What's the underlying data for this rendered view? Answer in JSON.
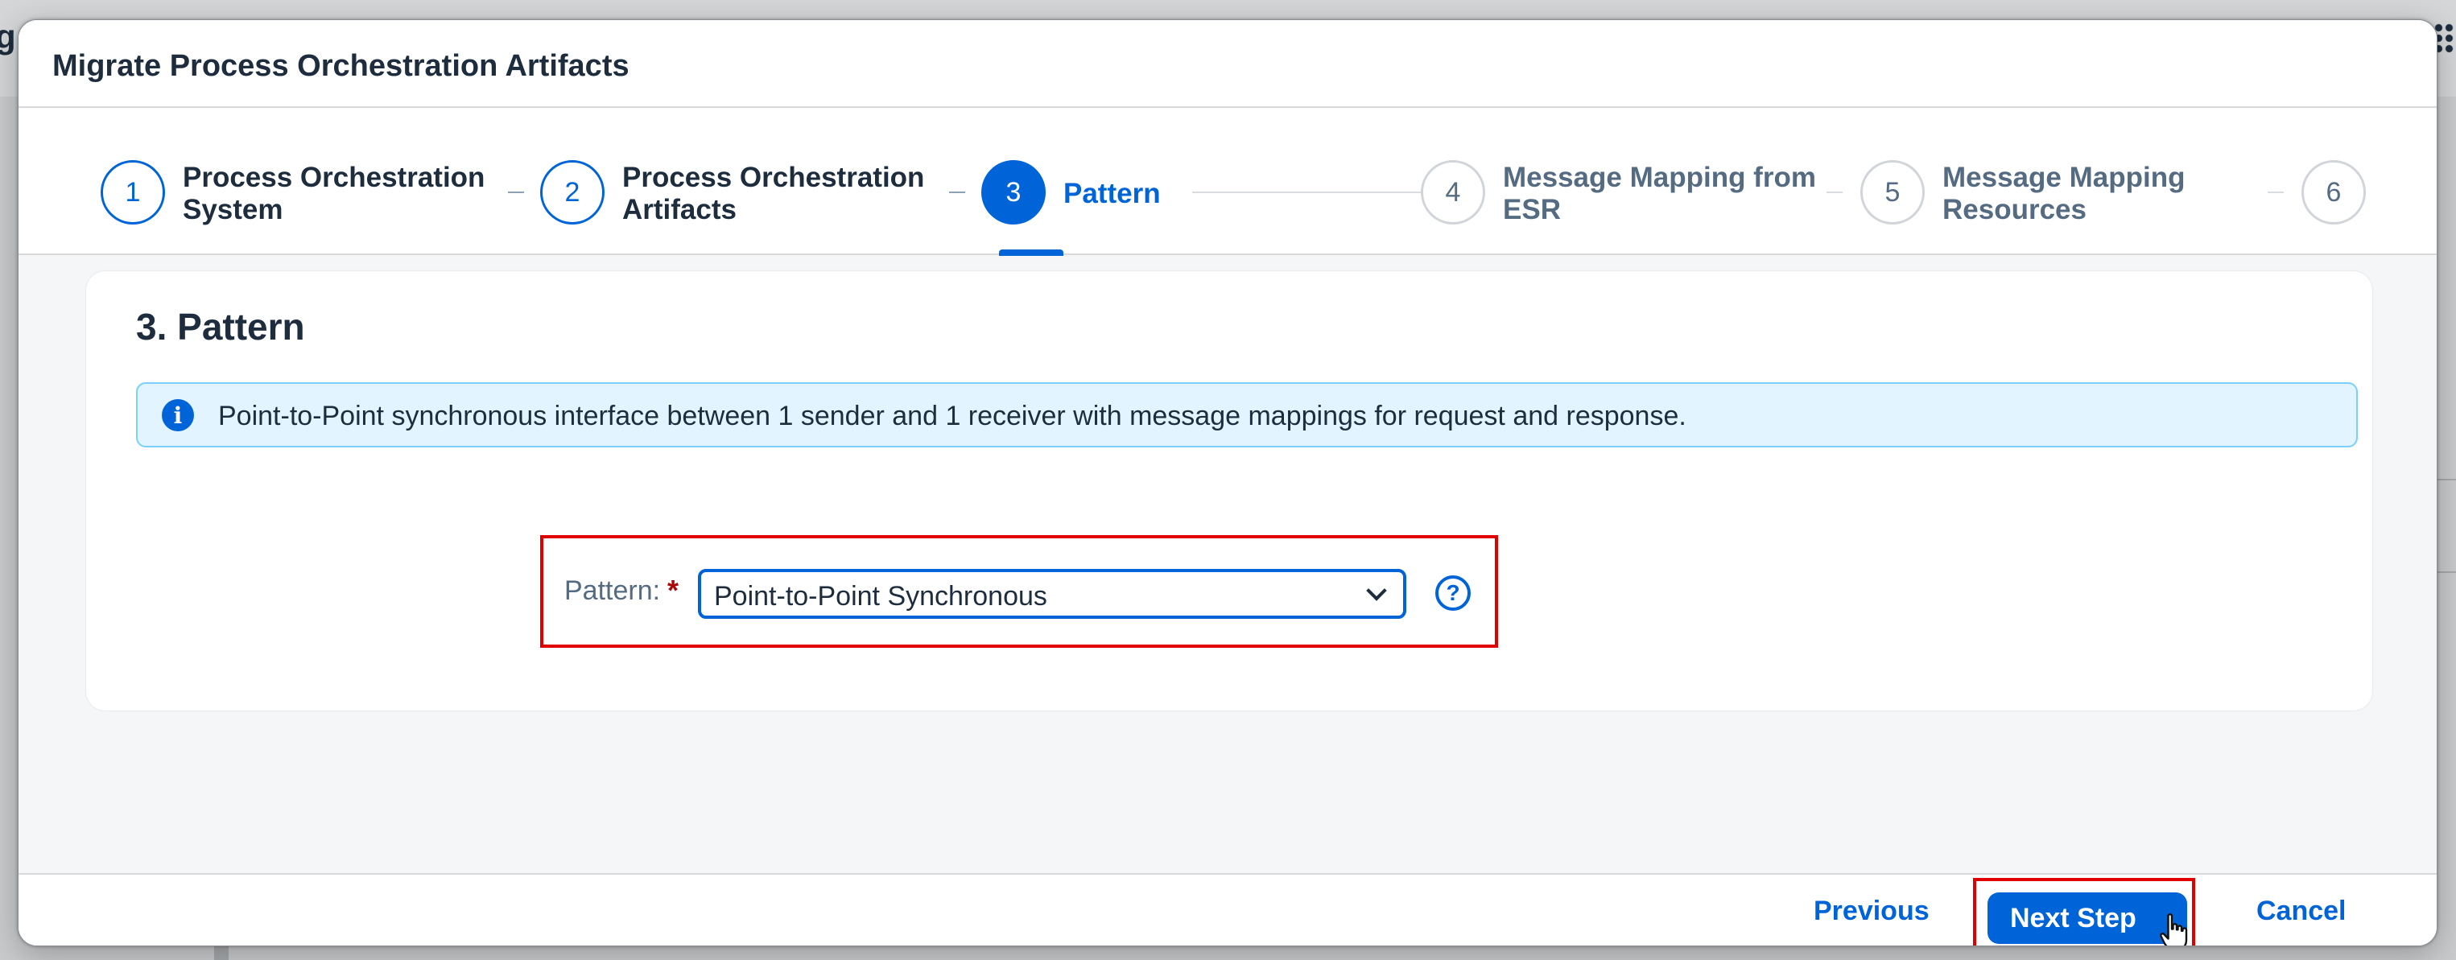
{
  "background": {
    "partial_letter": "g"
  },
  "dialog": {
    "title": "Migrate Process Orchestration Artifacts"
  },
  "wizard": {
    "steps": [
      {
        "number": "1",
        "label_line1": "Process Orchestration",
        "label_line2": "System",
        "state": "completed"
      },
      {
        "number": "2",
        "label_line1": "Process Orchestration",
        "label_line2": "Artifacts",
        "state": "completed"
      },
      {
        "number": "3",
        "label_line1": "Pattern",
        "label_line2": "",
        "state": "active"
      },
      {
        "number": "4",
        "label_line1": "Message Mapping from",
        "label_line2": "ESR",
        "state": "future"
      },
      {
        "number": "5",
        "label_line1": "Message Mapping",
        "label_line2": "Resources",
        "state": "future"
      },
      {
        "number": "6",
        "label_line1": "",
        "label_line2": "",
        "state": "future"
      }
    ]
  },
  "content": {
    "heading": "3. Pattern",
    "info_message": "Point-to-Point synchronous interface between 1 sender and 1 receiver with message mappings for request and response.",
    "pattern_field": {
      "label": "Pattern:",
      "required_marker": "*",
      "selected_value": "Point-to-Point Synchronous"
    }
  },
  "footer": {
    "previous_label": "Previous",
    "next_label": "Next Step",
    "cancel_label": "Cancel"
  },
  "icons": {
    "info": "info-icon",
    "help": "help-icon",
    "dropdown": "chevron-down-icon",
    "cursor": "hand-pointer-icon"
  },
  "colors": {
    "accent": "#0064d9",
    "highlight_border": "#e00000",
    "info_background": "#e1f4ff",
    "required": "#aa0808"
  }
}
